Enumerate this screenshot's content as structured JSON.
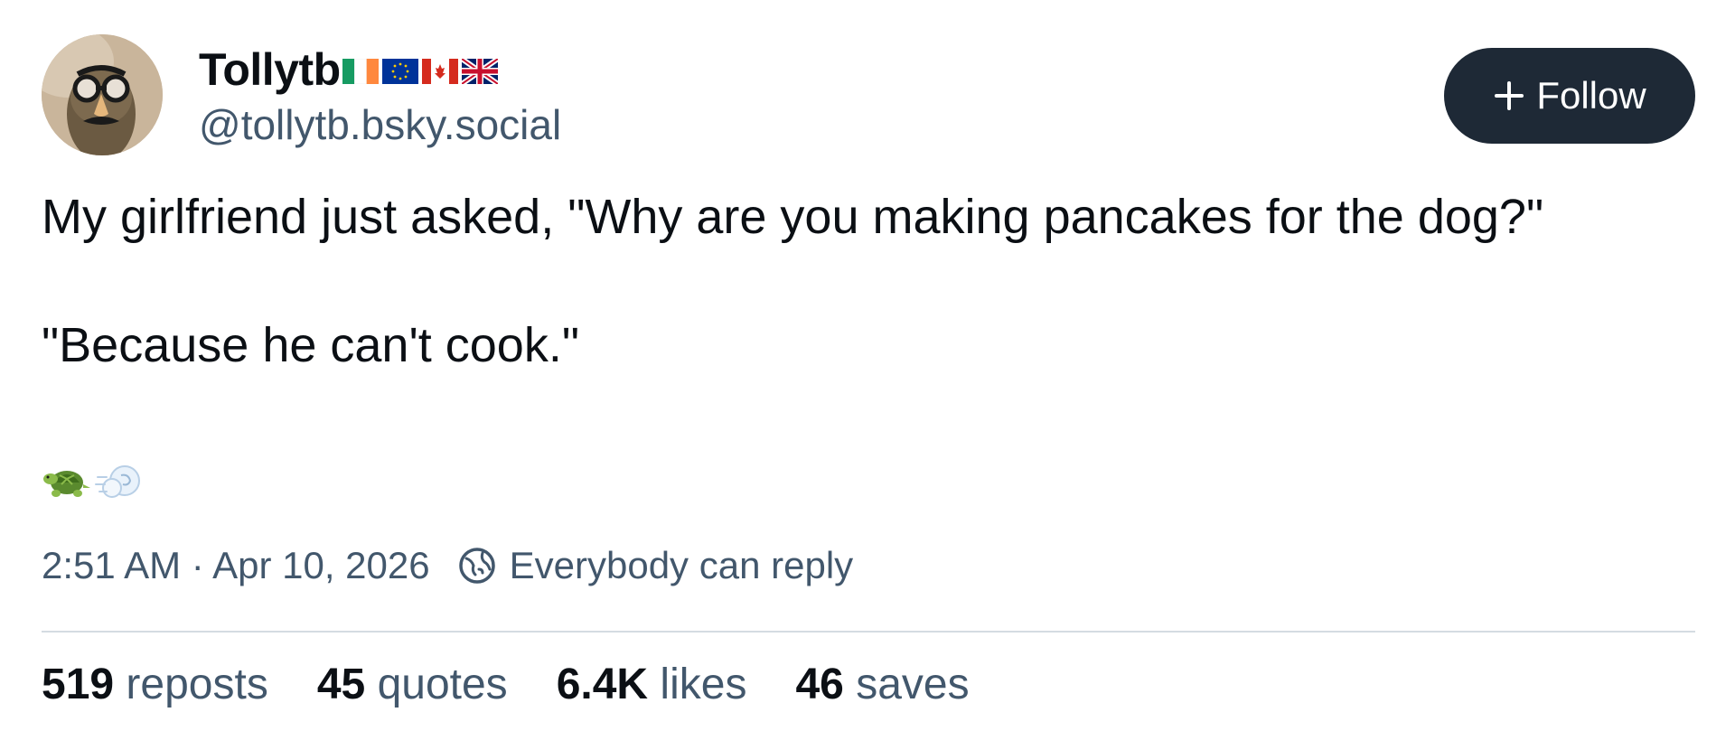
{
  "author": {
    "display_name": "Tollytb",
    "flags": [
      "ireland-flag",
      "eu-flag",
      "canada-flag",
      "uk-flag"
    ],
    "handle": "@tollytb.bsky.social"
  },
  "follow_button": {
    "label": "Follow",
    "icon": "plus-icon"
  },
  "post": {
    "line1": "My girlfriend just asked, \"Why are you making pancakes for the dog?\"",
    "line2": "\"Because he can't cook.\"",
    "emoji": [
      "turtle",
      "dash"
    ]
  },
  "meta": {
    "timestamp": "2:51 AM · Apr 10, 2026",
    "reply_setting": "Everybody can reply"
  },
  "stats": [
    {
      "count": "519",
      "label": "reposts"
    },
    {
      "count": "45",
      "label": "quotes"
    },
    {
      "count": "6.4K",
      "label": "likes"
    },
    {
      "count": "46",
      "label": "saves"
    }
  ],
  "colors": {
    "text": "#0b0f14",
    "muted": "#42576c",
    "button_bg": "#1e2936",
    "divider": "#d4dbe2"
  }
}
